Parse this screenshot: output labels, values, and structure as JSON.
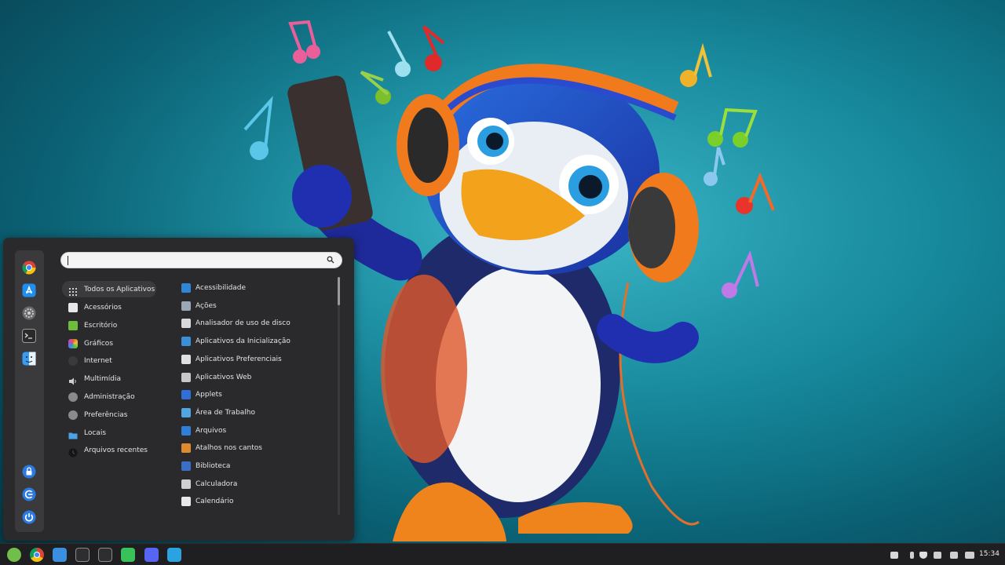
{
  "wallpaper": {
    "accent": "#178fa3"
  },
  "menu": {
    "search": {
      "value": "",
      "placeholder": ""
    },
    "favorites": [
      {
        "name": "chrome-icon"
      },
      {
        "name": "app-store-icon"
      },
      {
        "name": "settings-icon"
      },
      {
        "name": "terminal-icon"
      },
      {
        "name": "finder-icon"
      }
    ],
    "session": [
      {
        "name": "lock-screen-icon"
      },
      {
        "name": "logout-icon"
      },
      {
        "name": "power-icon"
      }
    ],
    "categories": [
      {
        "label": "Todos os Aplicativos",
        "icon": "grid-icon",
        "color": "#3b3b3e"
      },
      {
        "label": "Acessórios",
        "icon": "accessories-icon",
        "color": "#e8e8e8"
      },
      {
        "label": "Escritório",
        "icon": "office-icon",
        "color": "#6bbd3a"
      },
      {
        "label": "Gráficos",
        "icon": "graphics-icon",
        "color": "#e05a3a"
      },
      {
        "label": "Internet",
        "icon": "internet-icon",
        "color": "#3a3a3a"
      },
      {
        "label": "Multimídia",
        "icon": "multimedia-icon",
        "color": "#bdbdbd"
      },
      {
        "label": "Administração",
        "icon": "administration-icon",
        "color": "#8a8a8a"
      },
      {
        "label": "Preferências",
        "icon": "preferences-icon",
        "color": "#8a8a8a"
      },
      {
        "label": "Locais",
        "icon": "folder-icon",
        "color": "#4aa3e8"
      },
      {
        "label": "Arquivos recentes",
        "icon": "recent-files-icon",
        "color": "#1a1a1a"
      }
    ],
    "apps": [
      {
        "label": "Acessibilidade",
        "icon": "accessibility-icon",
        "color": "#2f86d9"
      },
      {
        "label": "Ações",
        "icon": "actions-icon",
        "color": "#9aa7b5"
      },
      {
        "label": "Analisador de uso de disco",
        "icon": "disk-usage-icon",
        "color": "#d9d9d9"
      },
      {
        "label": "Aplicativos da Inicialização",
        "icon": "startup-apps-icon",
        "color": "#3a8fd9"
      },
      {
        "label": "Aplicativos Preferenciais",
        "icon": "preferred-apps-icon",
        "color": "#e0e0e0"
      },
      {
        "label": "Aplicativos Web",
        "icon": "web-apps-icon",
        "color": "#c8c8c8"
      },
      {
        "label": "Applets",
        "icon": "applets-icon",
        "color": "#2f6fd9"
      },
      {
        "label": "Área de Trabalho",
        "icon": "desktop-icon",
        "color": "#4fa6e0"
      },
      {
        "label": "Arquivos",
        "icon": "files-icon",
        "color": "#2f7fd9"
      },
      {
        "label": "Atalhos nos cantos",
        "icon": "hot-corners-icon",
        "color": "#e08a2f"
      },
      {
        "label": "Biblioteca",
        "icon": "library-icon",
        "color": "#3a6fc8"
      },
      {
        "label": "Calculadora",
        "icon": "calculator-icon",
        "color": "#d0d0d0"
      },
      {
        "label": "Calendário",
        "icon": "calendar-icon",
        "color": "#e8e8e8"
      }
    ]
  },
  "taskbar": {
    "launchers": [
      {
        "name": "mint-menu-icon",
        "color": "#6fbf4a"
      },
      {
        "name": "chrome-icon",
        "color": "#e8e8e8"
      },
      {
        "name": "finder-icon",
        "color": "#3a8fe0"
      },
      {
        "name": "terminal-icon",
        "color": "#444444"
      },
      {
        "name": "system-monitor-icon",
        "color": "#444444"
      },
      {
        "name": "whatsapp-icon",
        "color": "#3ac25a"
      },
      {
        "name": "discord-icon",
        "color": "#5865f2"
      },
      {
        "name": "telegram-icon",
        "color": "#2aa3e0"
      }
    ],
    "tray": [
      {
        "name": "discord-tray-icon"
      },
      {
        "name": "bluetooth-icon"
      },
      {
        "name": "shield-icon"
      },
      {
        "name": "update-manager-icon"
      },
      {
        "name": "volume-icon"
      },
      {
        "name": "battery-icon"
      }
    ],
    "clock": "15:34"
  }
}
